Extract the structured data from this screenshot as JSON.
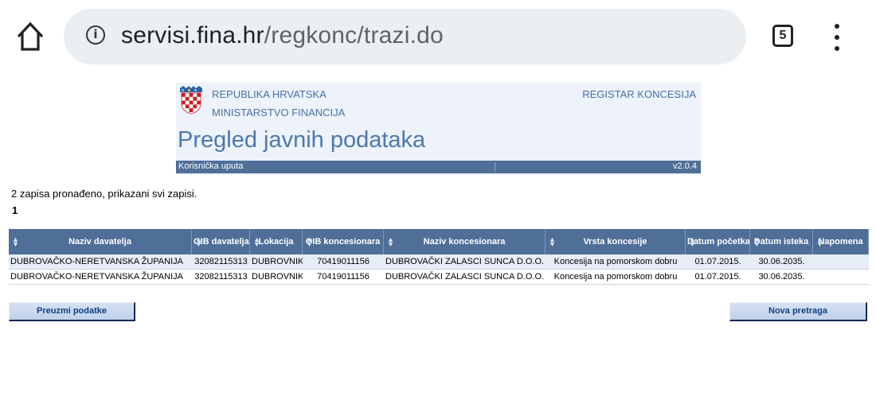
{
  "browser": {
    "url_host": "servisi.fina.hr",
    "url_path": "/regkonc/trazi.do",
    "tab_count": "5"
  },
  "header": {
    "republic": "REPUBLIKA HRVATSKA",
    "ministry": "MINISTARSTVO FINANCIJA",
    "registry": "REGISTAR KONCESIJA",
    "title": "Pregled javnih podataka",
    "user_guide": "Korisnička uputa",
    "version": "v2.0.4"
  },
  "results": {
    "summary": "2 zapisa pronađeno, prikazani svi zapisi.",
    "page": "1"
  },
  "table": {
    "columns": [
      "Naziv davatelja",
      "OIB davatelja",
      "Lokacija",
      "OIB koncesionara",
      "Naziv koncesionara",
      "Vrsta koncesije",
      "Datum početka",
      "Datum isteka",
      "Napomena"
    ],
    "rows": [
      [
        "DUBROVAČKO-NERETVANSKA ŽUPANIJA",
        "32082115313",
        "DUBROVNIK",
        "70419011156",
        "DUBROVAČKI ZALASCI SUNCA D.O.O.",
        "Koncesija na pomorskom dobru",
        "01.07.2015.",
        "30.06.2035.",
        ""
      ],
      [
        "DUBROVAČKO-NERETVANSKA ŽUPANIJA",
        "32082115313",
        "DUBROVNIK",
        "70419011156",
        "DUBROVAČKI ZALASCI SUNCA D.O.O.",
        "Koncesija na pomorskom dobru",
        "01.07.2015.",
        "30.06.2035.",
        ""
      ]
    ]
  },
  "buttons": {
    "download": "Preuzmi podatke",
    "new_search": "Nova pretraga"
  },
  "colors": {
    "header_blue": "#4f6f99",
    "link_blue": "#4671a8",
    "row_alt": "#e7edf6"
  }
}
